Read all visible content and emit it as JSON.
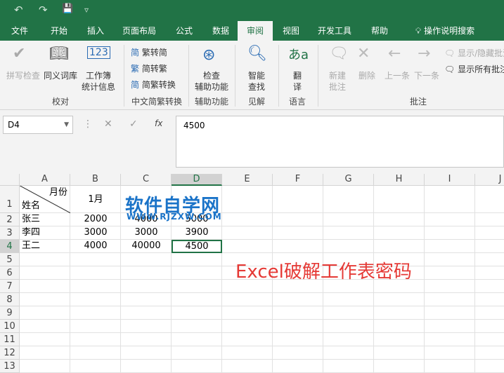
{
  "qat": {
    "undo": "↶",
    "redo": "↷",
    "save": "💾",
    "customize": "▿"
  },
  "tabs": [
    "文件",
    "开始",
    "插入",
    "页面布局",
    "公式",
    "数据",
    "审阅",
    "视图",
    "开发工具",
    "帮助"
  ],
  "active_tab": "审阅",
  "search": "操作说明搜索",
  "ribbon": {
    "spell": "拼写检查",
    "thesaurus": "同义词库",
    "stats1": "工作簿",
    "stats2": "统计信息",
    "group_proof": "校对",
    "t2s": "繁转简",
    "s2t": "简转繁",
    "convert": "简繁转换",
    "group_chinese": "中文简繁转换",
    "check1": "检查",
    "check2": "辅助功能",
    "group_access": "辅助功能",
    "smart1": "智能",
    "smart2": "查找",
    "group_insight": "见解",
    "trans1": "翻",
    "trans2": "译",
    "group_lang": "语言",
    "new1": "新建",
    "new2": "批注",
    "delete": "删除",
    "prev": "上一条",
    "next": "下一条",
    "showhide": "显示/隐藏批注",
    "showall": "显示所有批注",
    "group_comments": "批注"
  },
  "namebox": "D4",
  "fx": "fx",
  "formula": "4500",
  "columns": [
    "A",
    "B",
    "C",
    "D",
    "E",
    "F",
    "G",
    "H",
    "I",
    "J"
  ],
  "rows": [
    "1",
    "2",
    "3",
    "4",
    "5",
    "6",
    "7",
    "8",
    "9",
    "10",
    "11",
    "12",
    "13"
  ],
  "cells": {
    "a1_top": "月份",
    "a1_bottom": "姓名",
    "b1": "1月",
    "a2": "张三",
    "b2": "2000",
    "c2": "4000",
    "d2": "5000",
    "a3": "李四",
    "b3": "3000",
    "c3": "3000",
    "d3": "3900",
    "a4": "王二",
    "b4": "4000",
    "c4": "40000",
    "d4": "4500"
  },
  "watermark": "软件自学网",
  "watermark_url": "WWW.RJZXW.COM",
  "caption": "Excel破解工作表密码",
  "colors": {
    "accent": "#217346",
    "caption": "#e53935",
    "watermark": "#1a73c8"
  }
}
